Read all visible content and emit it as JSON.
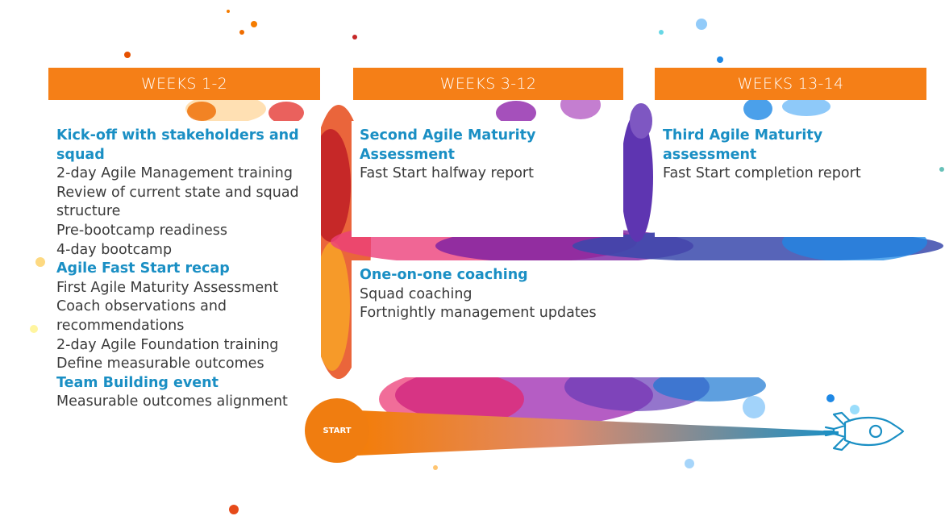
{
  "headers": [
    "WEEKS 1-2",
    "WEEKS 3-12",
    "WEEKS 13-14"
  ],
  "col1": [
    {
      "text": "Kick-off with stakeholders and squad",
      "heading": true
    },
    {
      "text": "2-day Agile Management training",
      "heading": false
    },
    {
      "text": "Review of current state and squad structure",
      "heading": false
    },
    {
      "text": "Pre-bootcamp readiness",
      "heading": false
    },
    {
      "text": "4-day bootcamp",
      "heading": false
    },
    {
      "text": "Agile Fast Start recap",
      "heading": true
    },
    {
      "text": "First Agile Maturity Assessment",
      "heading": false
    },
    {
      "text": "Coach observations and recommendations",
      "heading": false
    },
    {
      "text": "2-day Agile Foundation training",
      "heading": false
    },
    {
      "text": "Define measurable outcomes",
      "heading": false
    },
    {
      "text": "Team Building event",
      "heading": true
    },
    {
      "text": "Measurable outcomes alignment",
      "heading": false
    }
  ],
  "col2": [
    {
      "text": "Second Agile Maturity Assessment",
      "heading": true
    },
    {
      "text": "Fast Start halfway report",
      "heading": false
    }
  ],
  "col3": [
    {
      "text": "Third Agile Maturity assessment",
      "heading": true
    },
    {
      "text": "Fast Start completion report",
      "heading": false
    }
  ],
  "coaching": [
    {
      "text": "One-on-one coaching",
      "heading": true
    },
    {
      "text": "Squad coaching",
      "heading": false
    },
    {
      "text": "Fortnightly management updates",
      "heading": false
    }
  ],
  "start_label": "START",
  "colors": {
    "orange": "#f57f17",
    "heading_blue": "#1a8fc4",
    "body_text": "#3a3a3a"
  }
}
